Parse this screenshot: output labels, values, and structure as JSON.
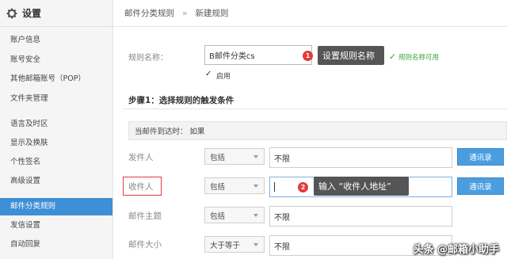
{
  "sidebar": {
    "title": "设置",
    "items": [
      {
        "label": "账户信息",
        "active": false
      },
      {
        "label": "账号安全",
        "active": false
      },
      {
        "label": "其他邮箱账号（POP）",
        "active": false
      },
      {
        "label": "文件夹管理",
        "active": false
      },
      {
        "label": "语言及时区",
        "active": false
      },
      {
        "label": "显示及换肤",
        "active": false
      },
      {
        "label": "个性签名",
        "active": false
      },
      {
        "label": "高级设置",
        "active": false
      },
      {
        "label": "邮件分类规则",
        "active": true
      },
      {
        "label": "发信设置",
        "active": false
      },
      {
        "label": "自动回复",
        "active": false
      }
    ]
  },
  "breadcrumb": {
    "parent": "邮件分类规则",
    "separator": "»",
    "current": "新建规则"
  },
  "rule_name": {
    "label": "规则名称：",
    "value": "B邮件分类cs",
    "valid_text": "规则名称可用",
    "enable_label": "启用",
    "enabled": true
  },
  "callouts": [
    {
      "number": "1",
      "text": "设置规则名称"
    },
    {
      "number": "2",
      "text": "输入 “收件人地址”"
    }
  ],
  "step1": {
    "title": "步骤1：选择规则的触发条件"
  },
  "condition_bar": {
    "text": "当邮件到达时： 如果"
  },
  "conditions": [
    {
      "label": "发件人",
      "operator": "包括",
      "value": "不限",
      "button": "通讯录"
    },
    {
      "label": "收件人",
      "operator": "包括",
      "value": "",
      "button": "通讯录"
    },
    {
      "label": "邮件主题",
      "operator": "包括",
      "value": "不限"
    },
    {
      "label": "邮件大小",
      "operator": "大于等于",
      "value": "不限"
    }
  ],
  "watermark": "头条 @邮箱小助手",
  "colors": {
    "accent": "#3d8fd6",
    "highlight": "#e23b3b",
    "valid": "#3aa53a"
  }
}
